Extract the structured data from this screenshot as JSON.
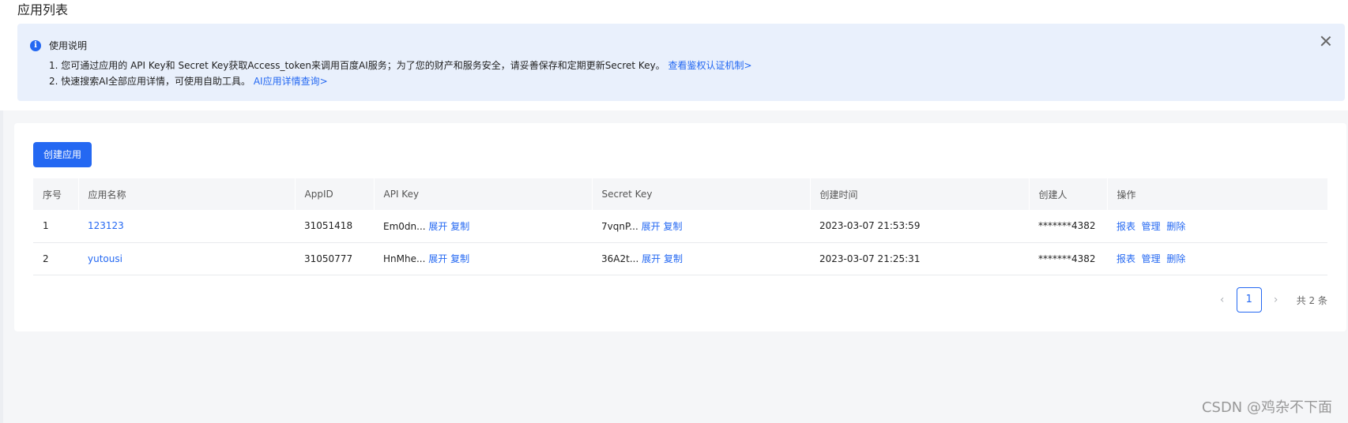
{
  "page": {
    "title": "应用列表"
  },
  "notice": {
    "title": "使用说明",
    "line1_text": "1. 您可通过应用的 API Key和 Secret Key获取Access_token来调用百度AI服务；为了您的财产和服务安全，请妥善保存和定期更新Secret Key。",
    "line1_link": "查看鉴权认证机制>",
    "line2_text": "2. 快速搜索AI全部应用详情，可使用自助工具。",
    "line2_link": "AI应用详情查询>",
    "icon": "info-icon",
    "close_icon": "close-icon"
  },
  "toolbar": {
    "create_label": "创建应用"
  },
  "table": {
    "headers": [
      "序号",
      "应用名称",
      "AppID",
      "API Key",
      "Secret Key",
      "创建时间",
      "创建人",
      "操作"
    ],
    "rows": [
      {
        "index": "1",
        "name": "123123",
        "appid": "31051418",
        "api_key": "Em0dn...",
        "secret_key": "7vqnP...",
        "created": "2023-03-07 21:53:59",
        "creator": "*******4382"
      },
      {
        "index": "2",
        "name": "yutousi",
        "appid": "31050777",
        "api_key": "HnMhe...",
        "secret_key": "36A2t...",
        "created": "2023-03-07 21:25:31",
        "creator": "*******4382"
      }
    ],
    "expand_label": "展开",
    "copy_label": "复制",
    "action_report": "报表",
    "action_manage": "管理",
    "action_delete": "删除"
  },
  "pagination": {
    "prev": "‹",
    "current": "1",
    "next": "›",
    "total": "共 2 条"
  },
  "watermark": "CSDN @鸡杂不下面",
  "colors": {
    "accent": "#2468f2",
    "notice_bg": "#e9f0fc",
    "page_bg": "#f5f6f8"
  }
}
